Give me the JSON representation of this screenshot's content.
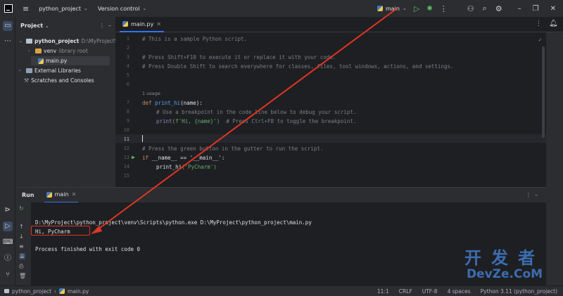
{
  "titlebar": {
    "project": "python_project",
    "vcs": "Version control",
    "run_config": "main"
  },
  "project_panel": {
    "title": "Project",
    "tree": [
      {
        "name": "python_project",
        "extra": "D:\\MyProject\\"
      },
      {
        "name": "venv",
        "extra": "library root"
      },
      {
        "name": "main.py",
        "extra": ""
      },
      {
        "name": "External Libraries",
        "extra": ""
      },
      {
        "name": "Scratches and Consoles",
        "extra": ""
      }
    ]
  },
  "editor": {
    "tab": "main.py",
    "usage_hint": "1 usage",
    "lines": {
      "l1": "# This is a sample Python script.",
      "l3": "# Press Shift+F10 to execute it or replace it with your code.",
      "l4": "# Press Double Shift to search everywhere for classes, files, tool windows, actions, and settings.",
      "l7_def": "def",
      "l7_fn": "print_hi",
      "l7_rest": "(name):",
      "l8": "# Use a breakpoint in the code line below to debug your script.",
      "l9_call": "print",
      "l9_arg": "(f'Hi, {name}')",
      "l9_cmt": "# Press Ctrl+F8 to toggle the breakpoint.",
      "l12": "# Press the green button in the gutter to run the script.",
      "l13_kw": "if",
      "l13_rest": "__name__ == '__main__':",
      "l14_fn": "print_hi",
      "l14_arg": "('PyCharm')"
    },
    "line_numbers": [
      "1",
      "2",
      "3",
      "4",
      "5",
      "6",
      "7",
      "8",
      "9",
      "10",
      "11",
      "12",
      "13",
      "14",
      "15"
    ]
  },
  "run_panel": {
    "title": "Run",
    "tab": "main",
    "output": [
      "D:\\MyProject\\python_project\\venv\\Scripts\\python.exe D:\\MyProject\\python_project\\main.py",
      "Hi, PyCharm",
      "",
      "Process finished with exit code 0"
    ]
  },
  "status_bar": {
    "crumb_project": "python_project",
    "crumb_file": "main.py",
    "position": "11:1",
    "line_sep": "CRLF",
    "encoding": "UTF-8",
    "indent": "4 spaces",
    "interpreter": "Python 3.11 (python_project)"
  },
  "watermark": {
    "cn": "开发者",
    "en": "DevZe.CoM"
  },
  "colors": {
    "accent": "#3574f0",
    "run_green": "#5fb865",
    "annotation_red": "#e03524"
  }
}
